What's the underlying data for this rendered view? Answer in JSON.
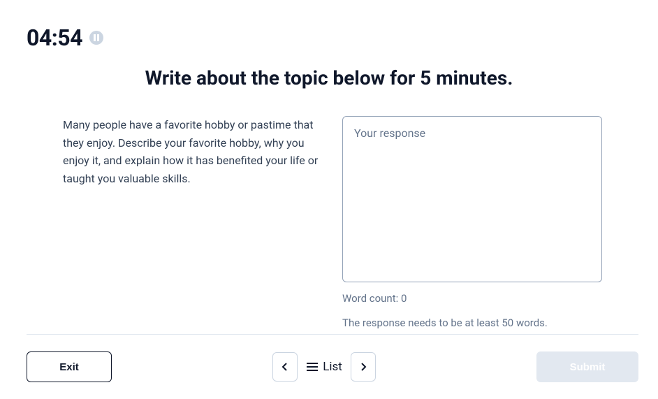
{
  "timer": {
    "value": "04:54"
  },
  "heading": "Write about the topic below for 5 minutes.",
  "prompt": "Many people have a favorite hobby or pastime that they enjoy. Describe your favorite hobby, why you enjoy it, and explain how it has benefited your life or taught you valuable skills.",
  "response": {
    "placeholder": "Your response",
    "value": "",
    "word_count_label": "Word count: ",
    "word_count_value": "0",
    "min_words_message": "The response needs to be at least 50 words."
  },
  "footer": {
    "exit_label": "Exit",
    "list_label": "List",
    "submit_label": "Submit"
  }
}
